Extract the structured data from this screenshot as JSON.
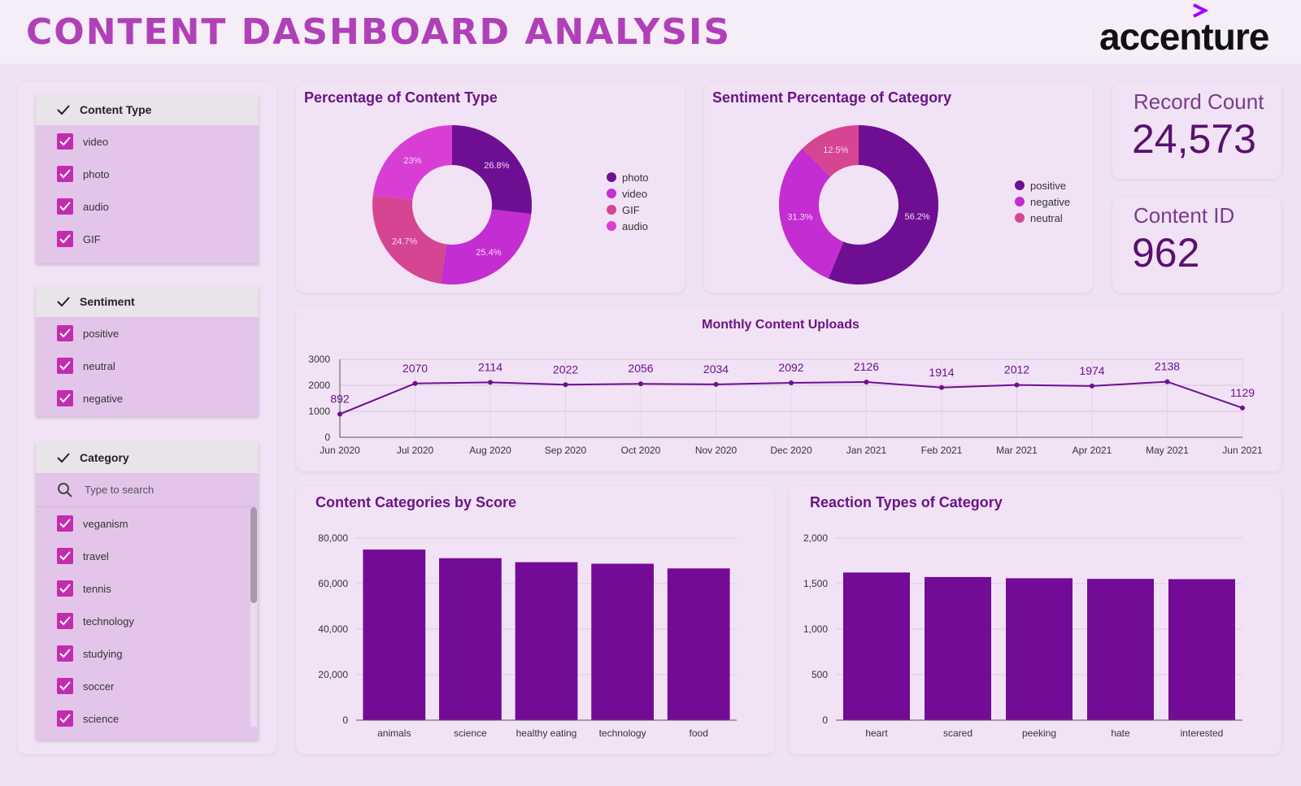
{
  "header": {
    "title": "CONTENT DASHBOARD ANALYSIS",
    "brand": "accenture"
  },
  "filters": {
    "content_type": {
      "label": "Content Type",
      "options": [
        "video",
        "photo",
        "audio",
        "GIF"
      ]
    },
    "sentiment": {
      "label": "Sentiment",
      "options": [
        "positive",
        "neutral",
        "negative"
      ]
    },
    "category": {
      "label": "Category",
      "search_placeholder": "Type to search",
      "options": [
        "veganism",
        "travel",
        "tennis",
        "technology",
        "studying",
        "soccer",
        "science"
      ]
    }
  },
  "kpis": {
    "record_count": {
      "label": "Record Count",
      "value": "24,573"
    },
    "content_id": {
      "label": "Content ID",
      "value": "962"
    }
  },
  "colors": {
    "dark_purple": "#6e0f93",
    "magenta": "#c32dd1",
    "pink": "#d64592",
    "bar": "#730b96"
  },
  "chart_data": [
    {
      "type": "pie",
      "title": "Percentage of Content Type",
      "slices": [
        {
          "label": "photo",
          "value": 26.8,
          "display": "26.8%",
          "color": "#6e0f93"
        },
        {
          "label": "video",
          "value": 25.4,
          "display": "25.4%",
          "color": "#c32dd1"
        },
        {
          "label": "GIF",
          "value": 24.7,
          "display": "24.7%",
          "color": "#d64592"
        },
        {
          "label": "audio",
          "value": 23.0,
          "display": "23%",
          "color": "#d93ed4"
        }
      ]
    },
    {
      "type": "pie",
      "title": "Sentiment Percentage of Category",
      "slices": [
        {
          "label": "positive",
          "value": 56.2,
          "display": "56.2%",
          "color": "#6e0f93"
        },
        {
          "label": "negative",
          "value": 31.3,
          "display": "31.3%",
          "color": "#c32dd1"
        },
        {
          "label": "neutral",
          "value": 12.5,
          "display": "12.5%",
          "color": "#d64592"
        }
      ]
    },
    {
      "type": "line",
      "title": "Monthly Content Uploads",
      "x": [
        "Jun 2020",
        "Jul 2020",
        "Aug 2020",
        "Sep 2020",
        "Oct 2020",
        "Nov 2020",
        "Dec 2020",
        "Jan 2021",
        "Feb 2021",
        "Mar 2021",
        "Apr 2021",
        "May 2021",
        "Jun 2021"
      ],
      "y": [
        892,
        2070,
        2114,
        2022,
        2056,
        2034,
        2092,
        2126,
        1914,
        2012,
        1974,
        2138,
        1129
      ],
      "yticks": [
        "0",
        "1000",
        "2000",
        "3000"
      ],
      "ylim": [
        0,
        3000
      ]
    },
    {
      "type": "bar",
      "title": "Content Categories by Score",
      "categories": [
        "animals",
        "science",
        "healthy eating",
        "technology",
        "food"
      ],
      "values": [
        74965,
        71168,
        69417,
        68738,
        66676
      ],
      "yticks": [
        "0",
        "20,000",
        "40,000",
        "60,000",
        "80,000"
      ],
      "ylim": [
        0,
        80000
      ]
    },
    {
      "type": "bar",
      "title": "Reaction Types of Category",
      "categories": [
        "heart",
        "scared",
        "peeking",
        "hate",
        "interested"
      ],
      "values": [
        1622,
        1572,
        1559,
        1552,
        1549
      ],
      "yticks": [
        "0",
        "500",
        "1,000",
        "1,500",
        "2,000"
      ],
      "ylim": [
        0,
        2000
      ]
    }
  ]
}
